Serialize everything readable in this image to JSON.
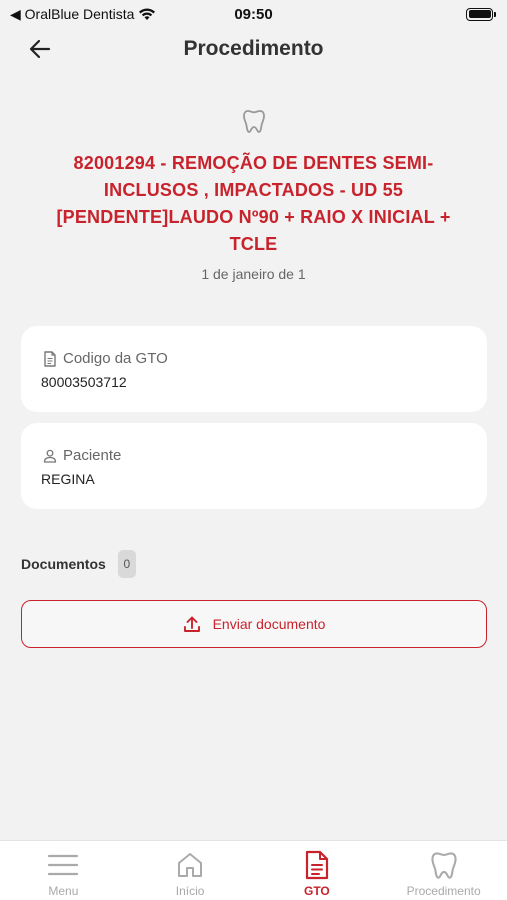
{
  "status_bar": {
    "back_app": "◀ OralBlue Dentista",
    "time": "09:50"
  },
  "header": {
    "title": "Procedimento"
  },
  "procedure": {
    "title": "82001294 - REMOÇÃO DE DENTES SEMI-INCLUSOS , IMPACTADOS - UD 55 [PENDENTE]LAUDO Nº90 + RAIO X INICIAL + TCLE",
    "date": "1 de janeiro de 1"
  },
  "gto_card": {
    "label": "Codigo da GTO",
    "value": "80003503712"
  },
  "patient_card": {
    "label": "Paciente",
    "value": "REGINA"
  },
  "documents": {
    "label": "Documentos",
    "count": "0",
    "send_button_label": "Enviar documento"
  },
  "tab_bar": {
    "items": [
      {
        "label": "Menu"
      },
      {
        "label": "Início"
      },
      {
        "label": "GTO"
      },
      {
        "label": "Procedimento"
      }
    ]
  },
  "colors": {
    "accent": "#c8232c",
    "background": "#f2f2f2",
    "card": "#ffffff"
  }
}
